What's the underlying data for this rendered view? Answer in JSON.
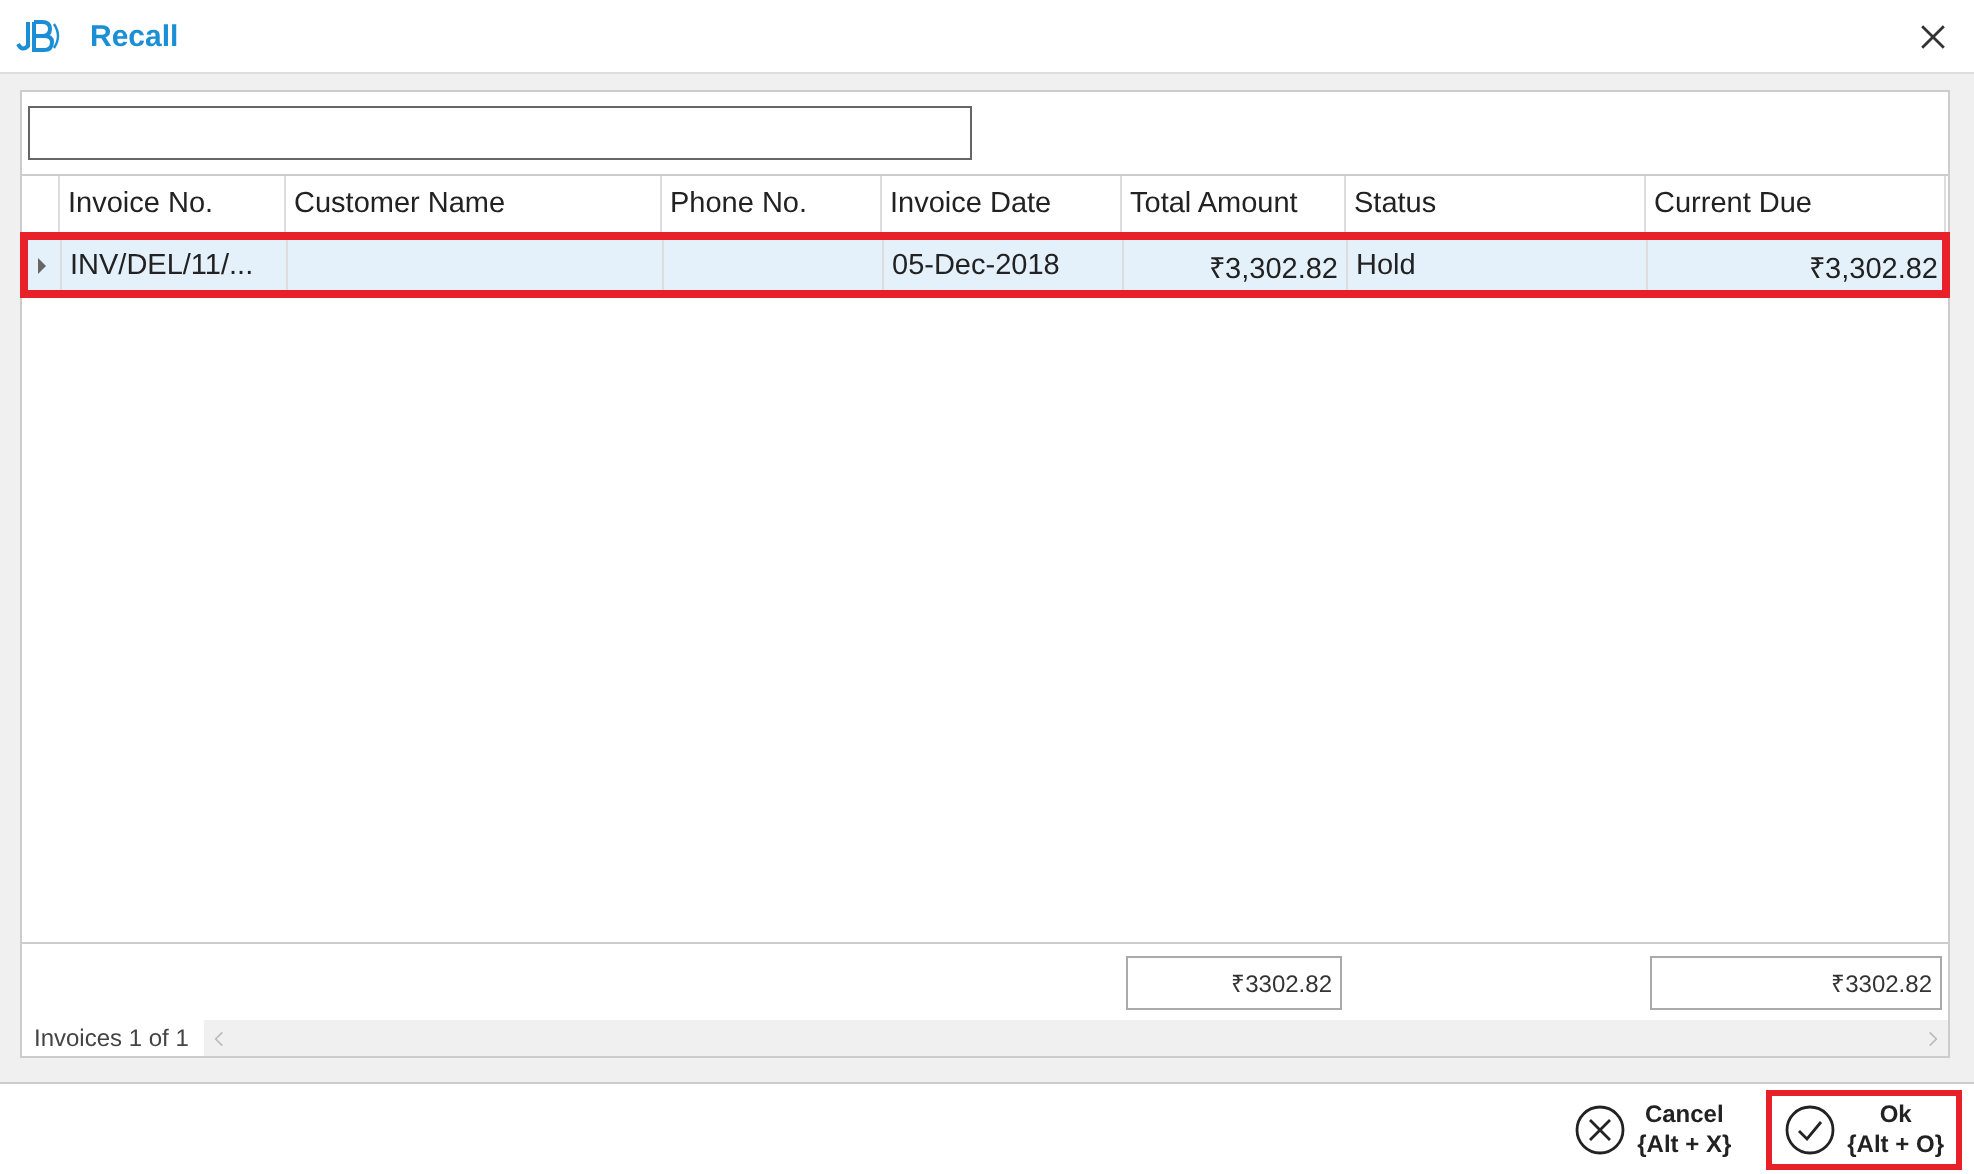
{
  "window": {
    "title": "Recall"
  },
  "table": {
    "columns": [
      {
        "label": "Invoice No."
      },
      {
        "label": "Customer Name"
      },
      {
        "label": "Phone No."
      },
      {
        "label": "Invoice Date"
      },
      {
        "label": "Total Amount",
        "total": "₹3302.82"
      },
      {
        "label": "Status"
      },
      {
        "label": "Current Due",
        "total": "₹3302.82"
      }
    ],
    "rows": [
      {
        "cells": [
          "INV/DEL/11/...",
          "",
          "",
          "05-Dec-2018",
          "₹3,302.82",
          "Hold",
          "₹3,302.82"
        ],
        "selected": true,
        "current": true,
        "highlighted": true
      }
    ]
  },
  "status_bar": {
    "text": "Invoices 1 of 1"
  },
  "buttons": [
    {
      "kind": "cancel",
      "label": "Cancel",
      "shortcut": "{Alt + X}",
      "highlighted": false
    },
    {
      "kind": "ok",
      "label": "Ok",
      "shortcut": "{Alt + O}",
      "highlighted": true
    }
  ]
}
